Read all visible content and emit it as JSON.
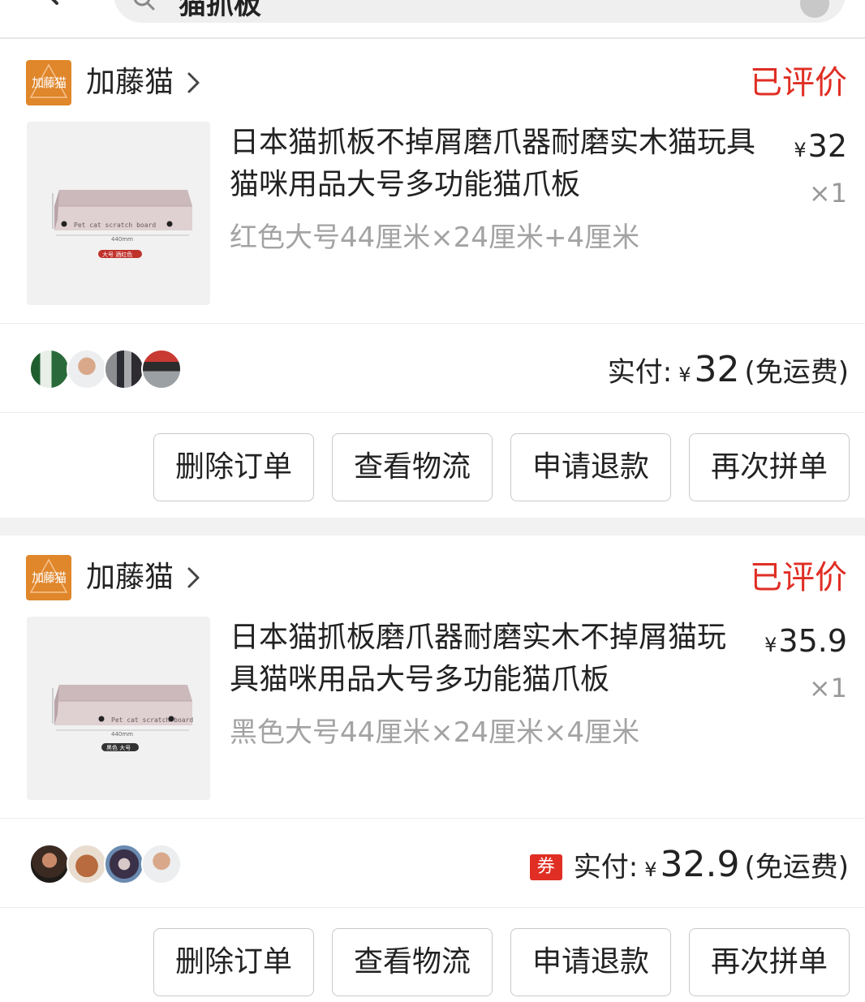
{
  "header": {
    "search_text": "猫抓板"
  },
  "orders": [
    {
      "shop_name": "加藤猫",
      "shop_logo_text": "加藤猫",
      "status": "已评价",
      "title": "日本猫抓板不掉屑磨爪器耐磨实木猫玩具猫咪用品大号多功能猫爪板",
      "price_symbol": "¥",
      "price": "32",
      "quantity": "×1",
      "spec": "红色大号44厘米×24厘米+4厘米",
      "thumb_board_text": "Pet cat scratch board",
      "thumb_size_text": "440mm",
      "thumb_tag_text": "大号 酒红色",
      "coupon": "",
      "paid_label": "实付:",
      "paid_symbol": "¥",
      "paid_amount": "32",
      "shipping": "(免运费)",
      "buttons": [
        "删除订单",
        "查看物流",
        "申请退款",
        "再次拼单"
      ]
    },
    {
      "shop_name": "加藤猫",
      "shop_logo_text": "加藤猫",
      "status": "已评价",
      "title": "日本猫抓板磨爪器耐磨实木不掉屑猫玩具猫咪用品大号多功能猫爪板",
      "price_symbol": "¥",
      "price": "35.9",
      "quantity": "×1",
      "spec": "黑色大号44厘米×24厘米×4厘米",
      "thumb_board_text": "Pet cat scratch board",
      "thumb_size_text": "440mm",
      "thumb_tag_text": "黑色 大号",
      "coupon": "券",
      "paid_label": "实付:",
      "paid_symbol": "¥",
      "paid_amount": "32.9",
      "shipping": "(免运费)",
      "buttons": [
        "删除订单",
        "查看物流",
        "申请退款",
        "再次拼单"
      ]
    }
  ],
  "colors": {
    "accent_red": "#e02e24",
    "shop_logo_orange": "#e0862b",
    "muted_text": "#a3a3a3",
    "board_top": "#d9cbcd",
    "tag_red": "#c0312b",
    "tag_dark": "#333333"
  }
}
